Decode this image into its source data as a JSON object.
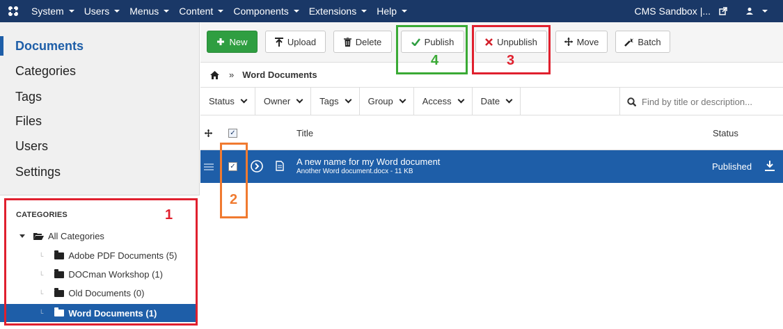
{
  "topbar": {
    "menus": [
      {
        "label": "System"
      },
      {
        "label": "Users"
      },
      {
        "label": "Menus"
      },
      {
        "label": "Content"
      },
      {
        "label": "Components"
      },
      {
        "label": "Extensions"
      },
      {
        "label": "Help"
      }
    ],
    "site_label": "CMS Sandbox |..."
  },
  "sidebar": {
    "items": [
      {
        "label": "Documents",
        "active": true
      },
      {
        "label": "Categories"
      },
      {
        "label": "Tags"
      },
      {
        "label": "Files"
      },
      {
        "label": "Users"
      },
      {
        "label": "Settings"
      }
    ],
    "categories_title": "CATEGORIES",
    "categories": [
      {
        "label": "All Categories"
      },
      {
        "label": "Adobe PDF Documents (5)"
      },
      {
        "label": "DOCman Workshop (1)"
      },
      {
        "label": "Old Documents (0)"
      },
      {
        "label": "Word Documents (1)",
        "selected": true
      }
    ]
  },
  "toolbar": {
    "new_label": "New",
    "upload_label": "Upload",
    "delete_label": "Delete",
    "publish_label": "Publish",
    "unpublish_label": "Unpublish",
    "move_label": "Move",
    "batch_label": "Batch"
  },
  "breadcrumb": {
    "separator": "»",
    "current": "Word Documents"
  },
  "filters": [
    {
      "label": "Status"
    },
    {
      "label": "Owner"
    },
    {
      "label": "Tags"
    },
    {
      "label": "Group"
    },
    {
      "label": "Access"
    },
    {
      "label": "Date"
    }
  ],
  "search": {
    "placeholder": "Find by title or description..."
  },
  "table": {
    "columns": {
      "title": "Title",
      "status": "Status"
    },
    "rows": [
      {
        "title": "A new name for my Word document",
        "subtitle": "Another Word document.docx - 11 KB",
        "status": "Published"
      }
    ]
  },
  "annotations": [
    {
      "number": "1",
      "color": "#e0202e"
    },
    {
      "number": "2",
      "color": "#f07a30"
    },
    {
      "number": "3",
      "color": "#e0202e"
    },
    {
      "number": "4",
      "color": "#3aaa35"
    }
  ],
  "colors": {
    "topbar": "#1a3867",
    "accent": "#1e5ea8",
    "new_button": "#2f9e41"
  }
}
